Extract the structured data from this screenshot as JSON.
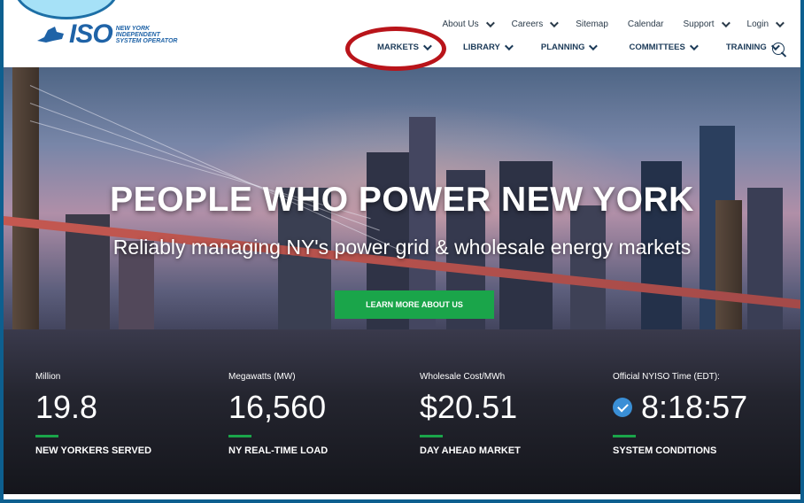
{
  "header": {
    "logo_text": "ISO",
    "logo_sub": "NEW YORK INDEPENDENT SYSTEM OPERATOR",
    "utility": [
      "About Us",
      "Careers",
      "Sitemap",
      "Calendar",
      "Support",
      "Login"
    ],
    "nav": [
      "MARKETS",
      "LIBRARY",
      "PLANNING",
      "COMMITTEES",
      "TRAINING"
    ]
  },
  "hero": {
    "headline": "PEOPLE WHO POWER NEW YORK",
    "subline": "Reliably managing NY's power grid & wholesale energy markets",
    "cta": "LEARN MORE ABOUT US"
  },
  "stats": [
    {
      "label": "Million",
      "value": "19.8",
      "name": "NEW YORKERS SERVED"
    },
    {
      "label": "Megawatts (MW)",
      "value": "16,560",
      "name": "NY REAL-TIME LOAD"
    },
    {
      "label": "Wholesale Cost/MWh",
      "value": "$20.51",
      "name": "DAY AHEAD MARKET"
    },
    {
      "label": "Official NYISO Time (EDT):",
      "value": "8:18:57",
      "name": "SYSTEM CONDITIONS"
    }
  ],
  "colors": {
    "brand": "#1f63a7",
    "accent": "#1aa54a",
    "annotation": "#b9141a"
  },
  "icons": [
    "state-map-logo-icon",
    "chevron-down-icon",
    "search-icon",
    "check-circle-icon"
  ]
}
